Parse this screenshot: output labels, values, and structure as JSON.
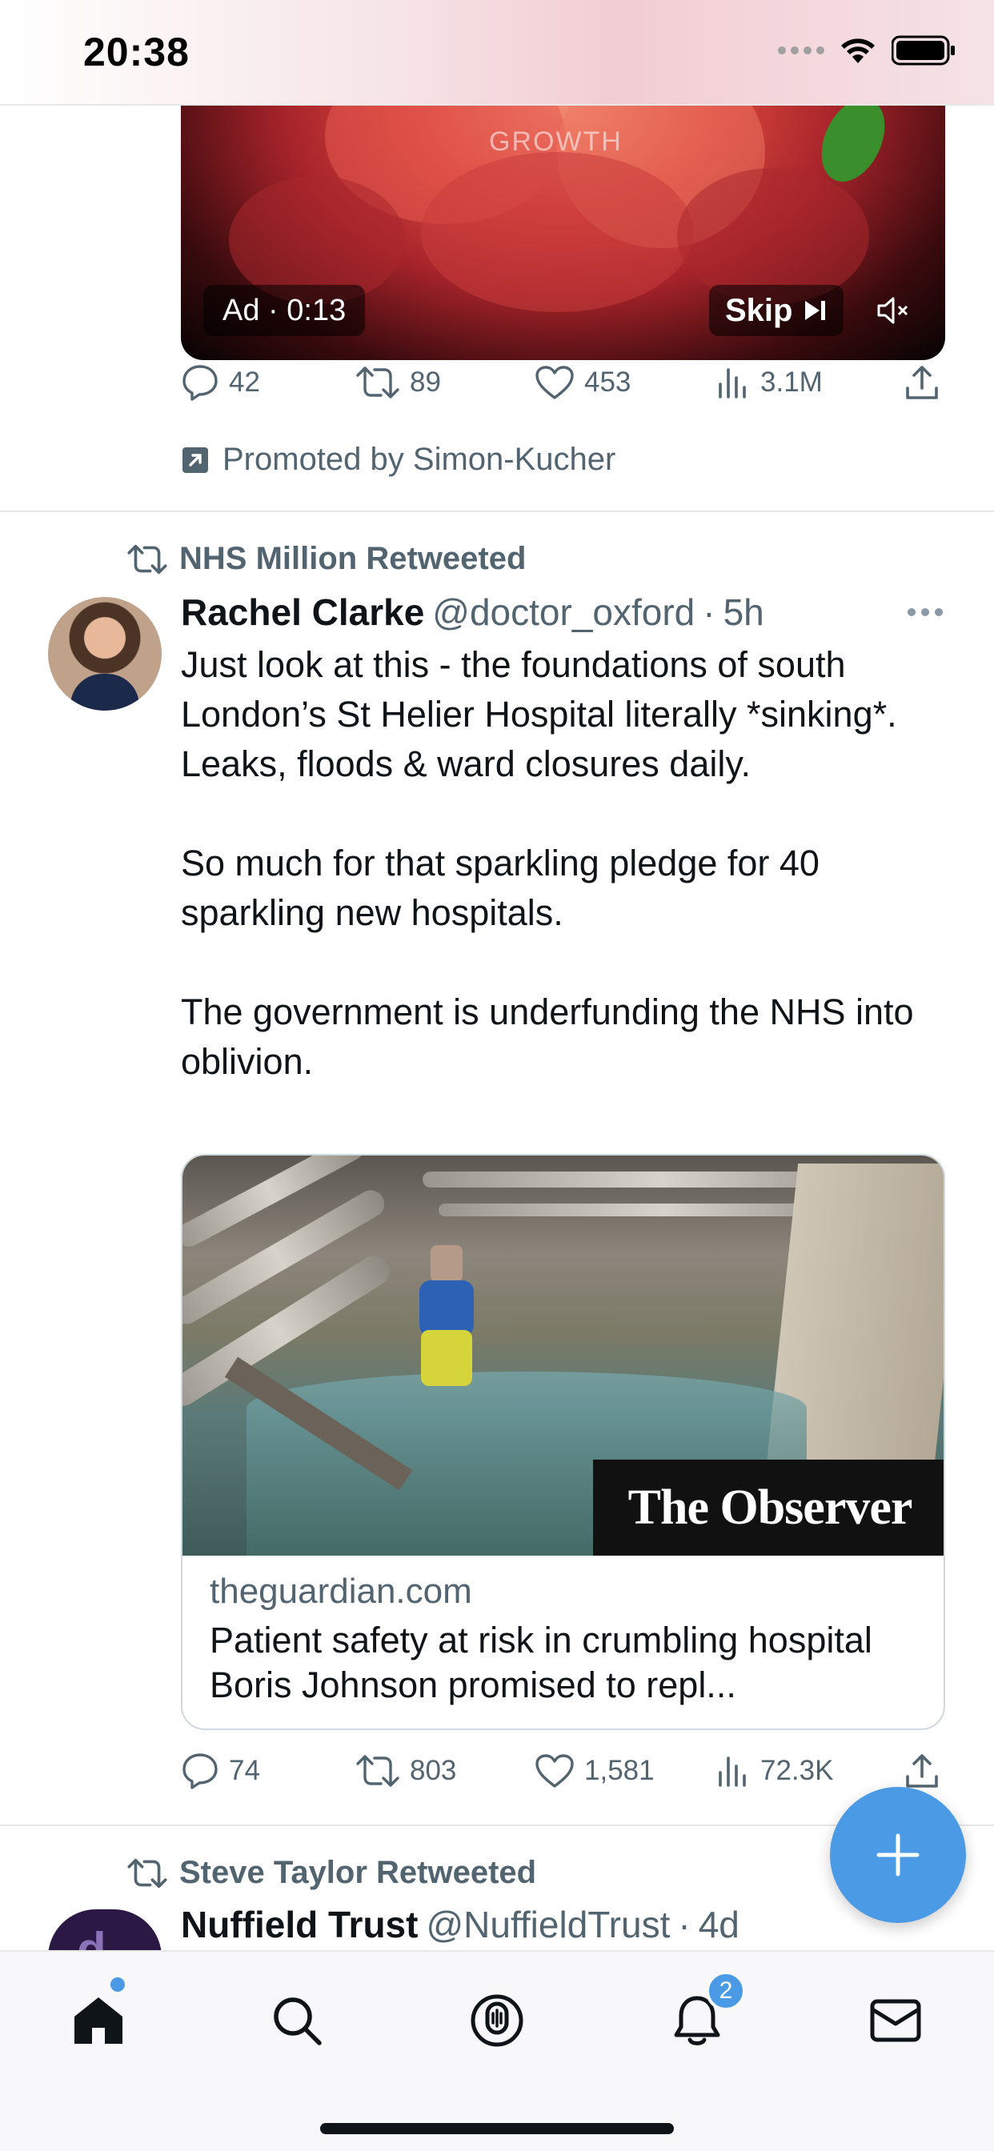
{
  "status_bar": {
    "time": "20:38"
  },
  "ad_tweet": {
    "video_overlay_text": "GROWTH",
    "ad_label": "Ad · 0:13",
    "skip_label": "Skip",
    "actions": {
      "replies": "42",
      "retweets": "89",
      "likes": "453",
      "views": "3.1M"
    },
    "promoted_text": "Promoted by Simon-Kucher"
  },
  "tweet1": {
    "retweeted_by": "NHS Million Retweeted",
    "author_name": "Rachel Clarke",
    "handle": "@doctor_oxford",
    "separator": "·",
    "time": "5h",
    "paragraphs": [
      "Just look at this - the foundations of south London’s St Helier Hospital literally *sinking*. Leaks, floods & ward closures daily.",
      "So much for that sparkling pledge for 40 sparkling new hospitals.",
      "The government is underfunding the NHS into oblivion."
    ],
    "card": {
      "image_logo_text": "The Observer",
      "domain": "theguardian.com",
      "title": "Patient safety at risk in crumbling hospital Boris Johnson promised to repl..."
    },
    "actions": {
      "replies": "74",
      "retweets": "803",
      "likes": "1,581",
      "views": "72.3K"
    }
  },
  "tweet2": {
    "retweeted_by": "Steve Taylor Retweeted",
    "author_name": "Nuffield Trust",
    "handle": "@NuffieldTrust",
    "separator": "·",
    "time": "4d"
  },
  "tab_bar": {
    "notifications_badge": "2"
  },
  "colors": {
    "accent": "#4a9ae6",
    "secondary_text": "#536471",
    "primary_text": "#0f1419"
  }
}
